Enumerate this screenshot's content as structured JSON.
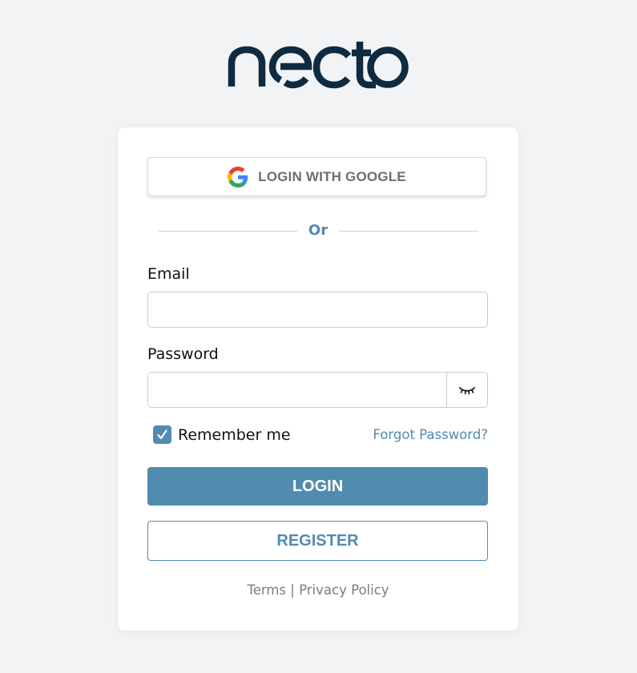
{
  "brand": {
    "logo_text": "necto",
    "logo_color": "#0f2b3f"
  },
  "google_login": {
    "label": "LOGIN WITH GOOGLE",
    "icon": "google-icon"
  },
  "divider": {
    "label": "Or"
  },
  "email": {
    "label": "Email",
    "value": "",
    "placeholder": ""
  },
  "password": {
    "label": "Password",
    "value": "",
    "placeholder": "",
    "toggle_icon": "eye-closed-icon"
  },
  "remember_me": {
    "label": "Remember me",
    "checked": true
  },
  "forgot_password": {
    "label": "Forgot Password?"
  },
  "login_button": {
    "label": "LOGIN"
  },
  "register_button": {
    "label": "REGISTER"
  },
  "footer": {
    "terms": "Terms",
    "separator": "|",
    "privacy": "Privacy Policy"
  },
  "colors": {
    "accent": "#528bb0",
    "background": "#f2f3f5",
    "card": "#ffffff"
  }
}
